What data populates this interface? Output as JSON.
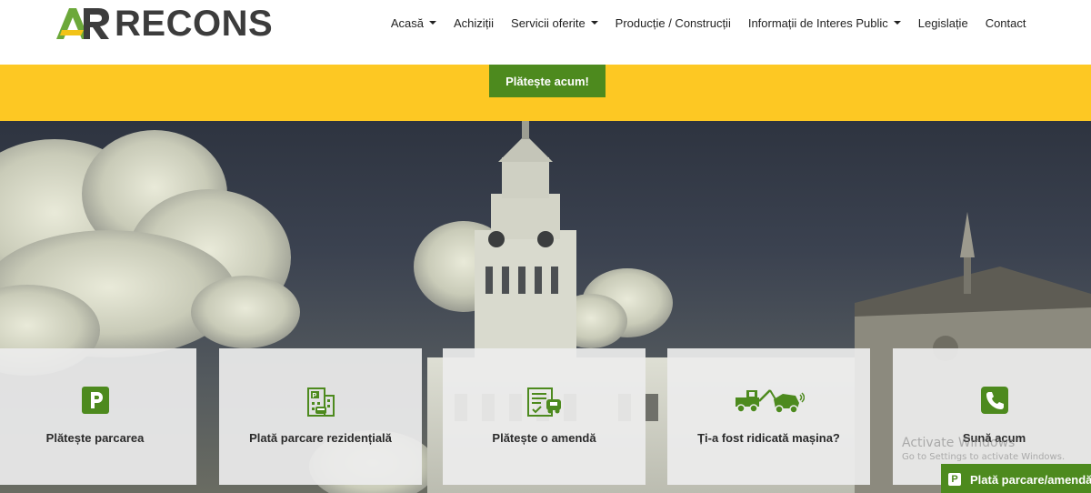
{
  "header": {
    "logo_text": "RECONS",
    "logo_mark": "AR",
    "nav": [
      {
        "label": "Acasă",
        "dropdown": true
      },
      {
        "label": "Achiziții",
        "dropdown": false
      },
      {
        "label": "Servicii oferite",
        "dropdown": true
      },
      {
        "label": "Producție / Construcții",
        "dropdown": false
      },
      {
        "label": "Informații de Interes Public",
        "dropdown": true
      },
      {
        "label": "Legislație",
        "dropdown": false
      },
      {
        "label": "Contact",
        "dropdown": false
      }
    ]
  },
  "paybar": {
    "button_label": "Plătește acum!",
    "color": "#fdc823"
  },
  "cards": [
    {
      "label": "Plătește parcarea",
      "icon": "parking-icon"
    },
    {
      "label": "Plată parcare rezidențială",
      "icon": "residential-parking-icon"
    },
    {
      "label": "Plătește o amendă",
      "icon": "fine-document-icon"
    },
    {
      "label": "Ți-a fost ridicată mașina?",
      "icon": "tow-truck-icon"
    },
    {
      "label": "Sună acum",
      "icon": "phone-icon"
    }
  ],
  "watermark": {
    "line1": "Activate Windows",
    "line2": "Go to Settings to activate Windows."
  },
  "float_button": {
    "label": "Plată parcare/amendă",
    "icon_letter": "P"
  },
  "colors": {
    "accent_green": "#4d8a1e",
    "yellow": "#fdc823",
    "logo_dark": "#3c3c3c"
  }
}
